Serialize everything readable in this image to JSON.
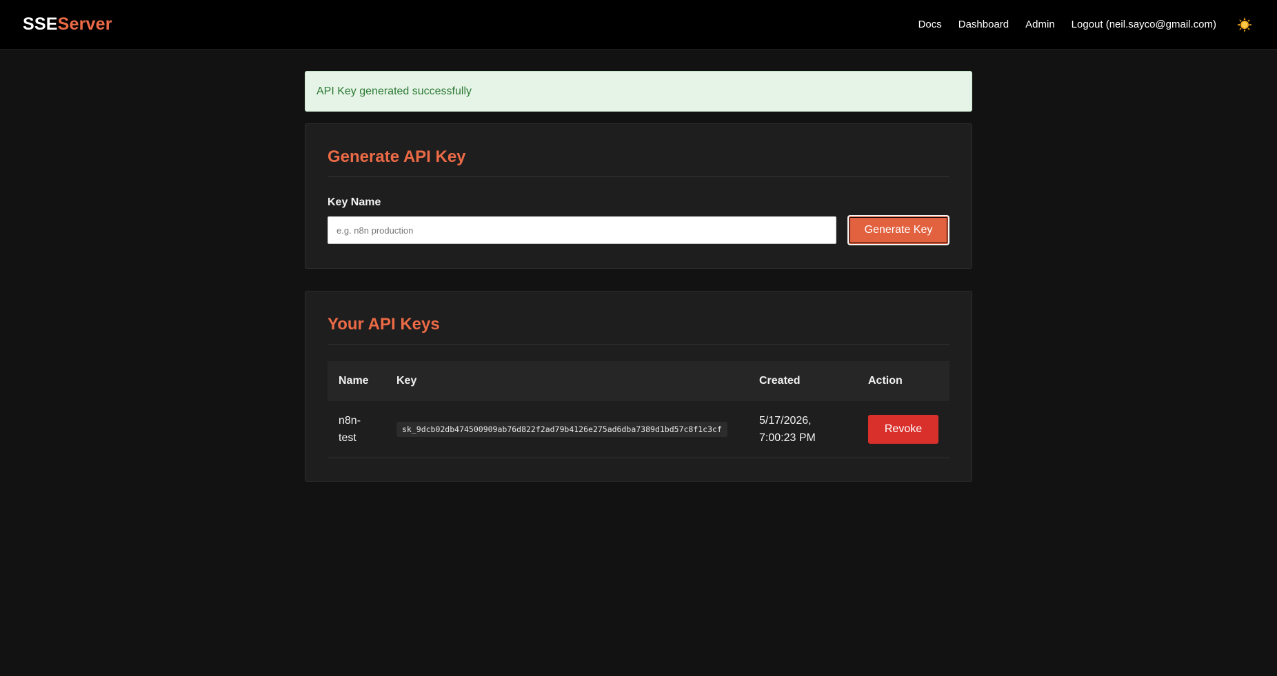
{
  "brand": {
    "part1": "SSE",
    "part2": "Server"
  },
  "nav": {
    "docs": "Docs",
    "dashboard": "Dashboard",
    "admin": "Admin",
    "logout": "Logout (neil.sayco@gmail.com)",
    "theme_icon": "sun-icon"
  },
  "alert": {
    "message": "API Key generated successfully"
  },
  "generate": {
    "title": "Generate API Key",
    "label": "Key Name",
    "input_value": "",
    "placeholder": "e.g. n8n production",
    "button": "Generate Key"
  },
  "keys": {
    "title": "Your API Keys",
    "columns": [
      "Name",
      "Key",
      "Created",
      "Action"
    ],
    "rows": [
      {
        "name": "n8n-test",
        "key": "sk_9dcb02db474500909ab76d822f2ad79b4126e275ad6dba7389d1bd57c8f1c3cf",
        "created": "5/17/2026, 7:00:23 PM",
        "action": "Revoke"
      }
    ]
  },
  "colors": {
    "accent": "#ec6a46",
    "revoke": "#d9302c",
    "success_bg": "#e6f4e7",
    "success_text": "#2c7a34"
  }
}
